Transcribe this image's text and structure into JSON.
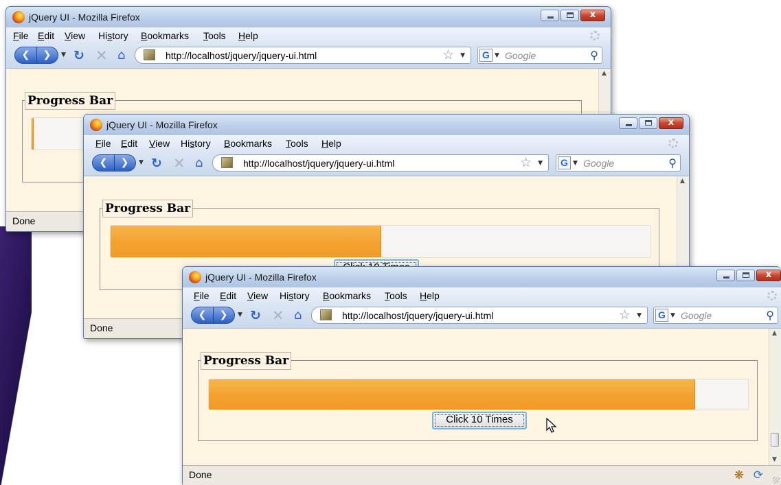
{
  "browser": {
    "title": "jQuery UI - Mozilla Firefox",
    "menu": {
      "file": {
        "ul": "F",
        "rest": "ile"
      },
      "edit": {
        "ul": "E",
        "rest": "dit"
      },
      "view": {
        "ul": "V",
        "rest": "iew"
      },
      "history": {
        "pre": "Hi",
        "ul": "s",
        "rest": "tory"
      },
      "bookmarks": {
        "ul": "B",
        "rest": "ookmarks"
      },
      "tools": {
        "ul": "T",
        "rest": "ools"
      },
      "help": {
        "ul": "H",
        "rest": "elp"
      }
    },
    "url": "http://localhost/jquery/jquery-ui.html",
    "search_placeholder": "Google",
    "search_engine_letter": "G",
    "status": "Done",
    "window_close_glyph": "x"
  },
  "page": {
    "legend": "Progress Bar",
    "button_label": "Click 10 Times"
  },
  "windows": [
    {
      "id": "win1",
      "progress": 0.0
    },
    {
      "id": "win2",
      "progress": 0.5
    },
    {
      "id": "win3",
      "progress": 0.9
    }
  ],
  "colors": {
    "progress_fill": "#f3a233",
    "page_background": "#fdf4e2",
    "titlebar": "#bccfe9"
  },
  "icons": {
    "back": "back-arrow-icon",
    "forward": "forward-arrow-icon",
    "reload": "reload-icon",
    "stop": "stop-icon",
    "home": "home-icon",
    "bookmark_star": "bookmark-star-icon",
    "search": "magnifier-search-icon",
    "firebug": "firebug-icon",
    "cursor": "mouse-cursor-icon"
  }
}
